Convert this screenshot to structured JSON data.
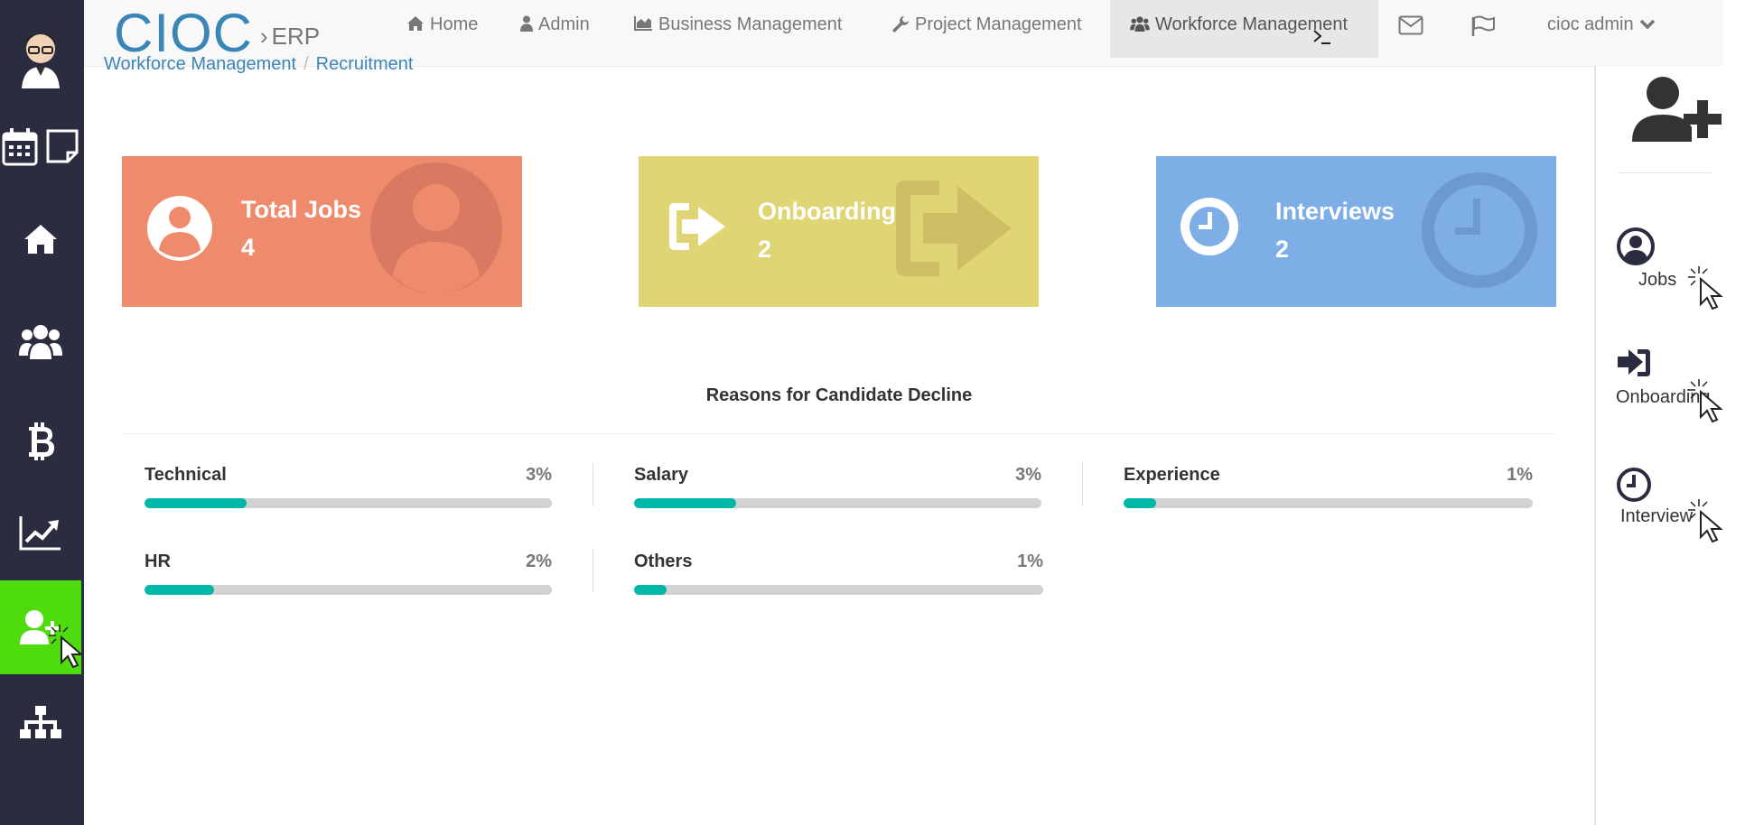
{
  "brand": {
    "name": "CIOC",
    "separator": "›",
    "suffix": "ERP"
  },
  "nav": {
    "items": [
      {
        "icon": "home-icon",
        "label": "Home"
      },
      {
        "icon": "user-icon",
        "label": "Admin"
      },
      {
        "icon": "area-chart-icon",
        "label": "Business Management"
      },
      {
        "icon": "wrench-icon",
        "label": "Project Management"
      },
      {
        "icon": "users-icon",
        "label": "Workforce Management",
        "active": true
      }
    ],
    "user_label": "cioc admin"
  },
  "breadcrumb": [
    "Workforce Management",
    "Recruitment"
  ],
  "tiles": [
    {
      "label": "Total Jobs",
      "value": "4",
      "color": "#ee8b6c",
      "icon": "user-circle-icon"
    },
    {
      "label": "Onboarding",
      "value": "2",
      "color": "#e0d574",
      "icon": "sign-in-icon"
    },
    {
      "label": "Interviews",
      "value": "2",
      "color": "#7eaee6",
      "icon": "clock-icon"
    }
  ],
  "section_title": "Reasons for Candidate Decline",
  "reasons": [
    {
      "name": "Technical",
      "pct_label": "3%",
      "fill_fraction": 0.25
    },
    {
      "name": "Salary",
      "pct_label": "3%",
      "fill_fraction": 0.25
    },
    {
      "name": "Experience",
      "pct_label": "1%",
      "fill_fraction": 0.08
    },
    {
      "name": "HR",
      "pct_label": "2%",
      "fill_fraction": 0.17
    },
    {
      "name": "Others",
      "pct_label": "1%",
      "fill_fraction": 0.08
    }
  ],
  "right_panel": {
    "items": [
      {
        "label": "Jobs",
        "icon": "user-circle-icon"
      },
      {
        "label": "Onboarding",
        "icon": "sign-in-icon"
      },
      {
        "label": "Interview",
        "icon": "clock-icon"
      }
    ]
  },
  "colors": {
    "accent": "#3a86b7",
    "sidebar": "#2b2c3f",
    "active_sidebar": "#4fdc0f",
    "progress": "#00b7a8"
  }
}
